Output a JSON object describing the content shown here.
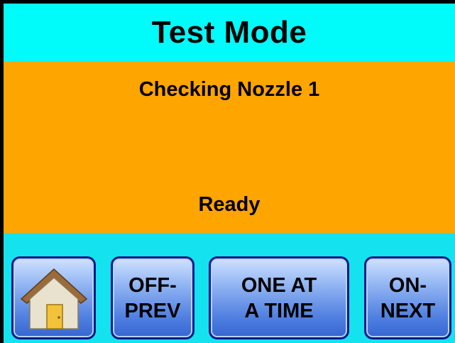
{
  "header": {
    "title": "Test Mode"
  },
  "status": {
    "message": "Checking Nozzle 1",
    "state": "Ready"
  },
  "buttons": {
    "home_icon": "home-icon",
    "off_prev_label": "OFF-\nPREV",
    "one_at_a_time_label": "ONE AT\nA TIME",
    "on_next_label": "ON-\nNEXT"
  },
  "colors": {
    "header_bg": "#00fbfb",
    "panel_bg": "#ffa500",
    "footer_bg": "#14e3ef",
    "button_border": "#0a1a86"
  }
}
